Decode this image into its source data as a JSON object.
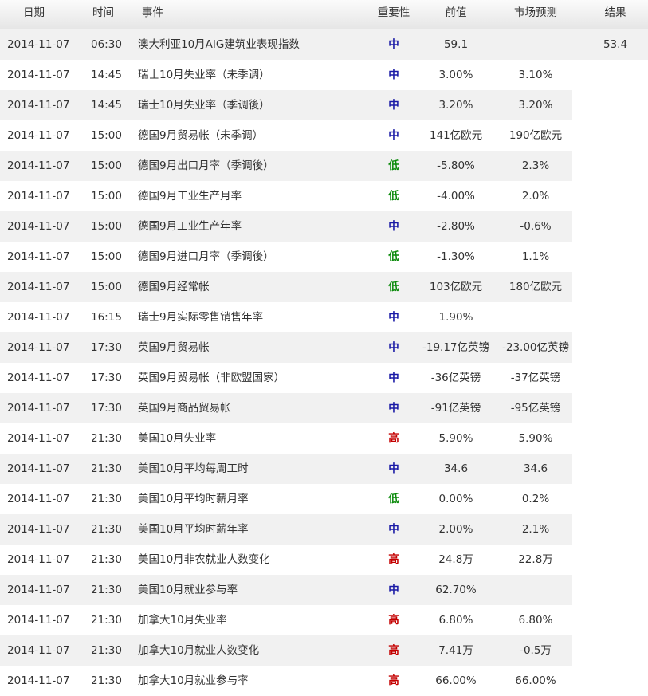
{
  "header": {
    "date": "日期",
    "time": "时间",
    "event": "事件",
    "importance": "重要性",
    "previous": "前值",
    "forecast": "市场预测",
    "result": "结果"
  },
  "colors": {
    "low": "#0a8a0a",
    "medium": "#1a1aa6",
    "high": "#c40000"
  },
  "rows": [
    {
      "date": "2014-11-07",
      "time": "06:30",
      "event": "澳大利亚10月AIG建筑业表现指数",
      "importance": "中",
      "level": "medium",
      "previous": "59.1",
      "forecast": "",
      "result": "53.4"
    },
    {
      "date": "2014-11-07",
      "time": "14:45",
      "event": "瑞士10月失业率（未季调）",
      "importance": "中",
      "level": "medium",
      "previous": "3.00%",
      "forecast": "3.10%",
      "result": ""
    },
    {
      "date": "2014-11-07",
      "time": "14:45",
      "event": "瑞士10月失业率（季调後）",
      "importance": "中",
      "level": "medium",
      "previous": "3.20%",
      "forecast": "3.20%",
      "result": ""
    },
    {
      "date": "2014-11-07",
      "time": "15:00",
      "event": "德国9月贸易帐（未季调）",
      "importance": "中",
      "level": "medium",
      "previous": "141亿欧元",
      "forecast": "190亿欧元",
      "result": ""
    },
    {
      "date": "2014-11-07",
      "time": "15:00",
      "event": "德国9月出口月率（季调後）",
      "importance": "低",
      "level": "low",
      "previous": "-5.80%",
      "forecast": "2.3%",
      "result": ""
    },
    {
      "date": "2014-11-07",
      "time": "15:00",
      "event": "德国9月工业生产月率",
      "importance": "低",
      "level": "low",
      "previous": "-4.00%",
      "forecast": "2.0%",
      "result": ""
    },
    {
      "date": "2014-11-07",
      "time": "15:00",
      "event": "德国9月工业生产年率",
      "importance": "中",
      "level": "medium",
      "previous": "-2.80%",
      "forecast": "-0.6%",
      "result": ""
    },
    {
      "date": "2014-11-07",
      "time": "15:00",
      "event": "德国9月进口月率（季调後）",
      "importance": "低",
      "level": "low",
      "previous": "-1.30%",
      "forecast": "1.1%",
      "result": ""
    },
    {
      "date": "2014-11-07",
      "time": "15:00",
      "event": "德国9月经常帐",
      "importance": "低",
      "level": "low",
      "previous": "103亿欧元",
      "forecast": "180亿欧元",
      "result": ""
    },
    {
      "date": "2014-11-07",
      "time": "16:15",
      "event": "瑞士9月实际零售销售年率",
      "importance": "中",
      "level": "medium",
      "previous": "1.90%",
      "forecast": "",
      "result": ""
    },
    {
      "date": "2014-11-07",
      "time": "17:30",
      "event": "英国9月贸易帐",
      "importance": "中",
      "level": "medium",
      "previous": "-19.17亿英镑",
      "forecast": "-23.00亿英镑",
      "result": ""
    },
    {
      "date": "2014-11-07",
      "time": "17:30",
      "event": "英国9月贸易帐（非欧盟国家）",
      "importance": "中",
      "level": "medium",
      "previous": "-36亿英镑",
      "forecast": "-37亿英镑",
      "result": ""
    },
    {
      "date": "2014-11-07",
      "time": "17:30",
      "event": "英国9月商品贸易帐",
      "importance": "中",
      "level": "medium",
      "previous": "-91亿英镑",
      "forecast": "-95亿英镑",
      "result": ""
    },
    {
      "date": "2014-11-07",
      "time": "21:30",
      "event": "美国10月失业率",
      "importance": "高",
      "level": "high",
      "previous": "5.90%",
      "forecast": "5.90%",
      "result": ""
    },
    {
      "date": "2014-11-07",
      "time": "21:30",
      "event": "美国10月平均每周工时",
      "importance": "中",
      "level": "medium",
      "previous": "34.6",
      "forecast": "34.6",
      "result": ""
    },
    {
      "date": "2014-11-07",
      "time": "21:30",
      "event": "美国10月平均时薪月率",
      "importance": "低",
      "level": "low",
      "previous": "0.00%",
      "forecast": "0.2%",
      "result": ""
    },
    {
      "date": "2014-11-07",
      "time": "21:30",
      "event": "美国10月平均时薪年率",
      "importance": "中",
      "level": "medium",
      "previous": "2.00%",
      "forecast": "2.1%",
      "result": ""
    },
    {
      "date": "2014-11-07",
      "time": "21:30",
      "event": "美国10月非农就业人数变化",
      "importance": "高",
      "level": "high",
      "previous": "24.8万",
      "forecast": "22.8万",
      "result": ""
    },
    {
      "date": "2014-11-07",
      "time": "21:30",
      "event": "美国10月就业参与率",
      "importance": "中",
      "level": "medium",
      "previous": "62.70%",
      "forecast": "",
      "result": ""
    },
    {
      "date": "2014-11-07",
      "time": "21:30",
      "event": "加拿大10月失业率",
      "importance": "高",
      "level": "high",
      "previous": "6.80%",
      "forecast": "6.80%",
      "result": ""
    },
    {
      "date": "2014-11-07",
      "time": "21:30",
      "event": "加拿大10月就业人数变化",
      "importance": "高",
      "level": "high",
      "previous": "7.41万",
      "forecast": "-0.5万",
      "result": ""
    },
    {
      "date": "2014-11-07",
      "time": "21:30",
      "event": "加拿大10月就业参与率",
      "importance": "高",
      "level": "high",
      "previous": "66.00%",
      "forecast": "66.00%",
      "result": ""
    }
  ]
}
